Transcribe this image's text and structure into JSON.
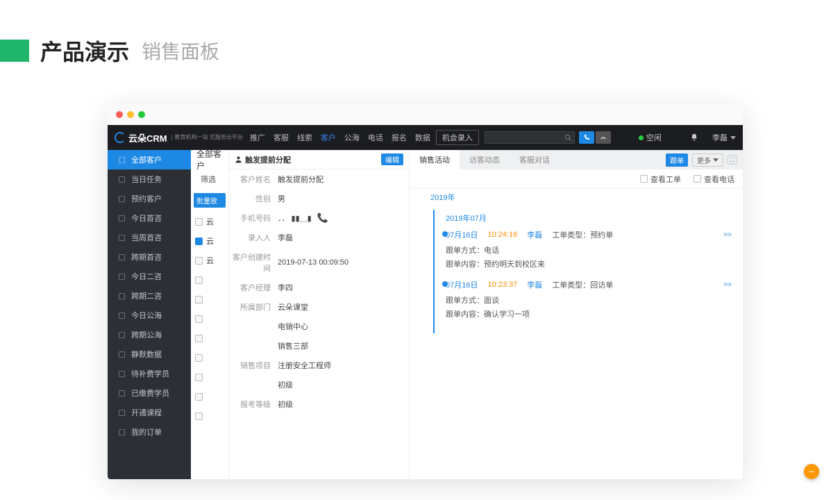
{
  "presentation": {
    "title": "产品演示",
    "subtitle": "销售面板"
  },
  "topnav": {
    "logo": "云朵CRM",
    "logo_sub": "教育机构一站\n式服务云平台",
    "items": [
      "推广",
      "客服",
      "线索",
      "客户",
      "公海",
      "电话",
      "报名",
      "数据"
    ],
    "active_index": 3,
    "chance_btn": "机会录入",
    "status": "空闲",
    "user": "李磊"
  },
  "sidebar": {
    "items": [
      {
        "icon": "user",
        "label": "全部客户"
      },
      {
        "icon": "check",
        "label": "当日任务"
      },
      {
        "icon": "people",
        "label": "预约客户"
      },
      {
        "icon": "chat",
        "label": "今日首咨"
      },
      {
        "icon": "chat",
        "label": "当周首咨"
      },
      {
        "icon": "chat",
        "label": "跨期首咨"
      },
      {
        "icon": "chat",
        "label": "今日二咨"
      },
      {
        "icon": "chat",
        "label": "跨期二咨"
      },
      {
        "icon": "sea",
        "label": "今日公海"
      },
      {
        "icon": "sea",
        "label": "跨期公海"
      },
      {
        "icon": "mute",
        "label": "静默数据"
      },
      {
        "icon": "pay",
        "label": "待补费学员"
      },
      {
        "icon": "paid",
        "label": "已缴费学员"
      },
      {
        "icon": "book",
        "label": "开通课程"
      },
      {
        "icon": "order",
        "label": "我的订单"
      }
    ],
    "active_index": 0
  },
  "mid": {
    "title": "全部客户",
    "filter": "筛选",
    "batch_btn": "批量放",
    "rows": [
      "云",
      "云",
      "云",
      "",
      "",
      "",
      "",
      "",
      "",
      "",
      ""
    ]
  },
  "detail": {
    "head_title": "触发提前分配",
    "edit": "编辑",
    "fields": [
      {
        "label": "客户姓名",
        "value": "触发提前分配"
      },
      {
        "label": "性别",
        "value": "男"
      },
      {
        "label": "手机号码",
        "value": "．． ▮▮␣▮",
        "phone": true
      },
      {
        "label": "录入人",
        "value": "李磊"
      },
      {
        "label": "客户创建时间",
        "value": "2019-07-13 00:09:50"
      },
      {
        "label": "客户经理",
        "value": "李四"
      },
      {
        "label": "所属部门",
        "value": "云朵课堂"
      },
      {
        "label": "",
        "value": "电销中心"
      },
      {
        "label": "",
        "value": "销售三部"
      },
      {
        "label": "销售项目",
        "value": "注册安全工程师"
      },
      {
        "label": "",
        "value": "初级"
      },
      {
        "label": "报考等级",
        "value": "初级"
      }
    ]
  },
  "activity": {
    "tabs": [
      "销售活动",
      "访客动态",
      "客服对话"
    ],
    "active_tab": 0,
    "follow_btn": "跟单",
    "more_btn": "更多",
    "check_ticket": "查看工单",
    "check_call": "查看电话",
    "year": "2019年",
    "month": "2019年07月",
    "entries": [
      {
        "date": "07月16日",
        "time": "10:24:16",
        "user": "李磊",
        "type_label": "工单类型：",
        "type": "预约单",
        "method_label": "跟单方式：",
        "method": "电话",
        "content_label": "跟单内容：",
        "content": "预约明天到校区来",
        "expand": ">>"
      },
      {
        "date": "07月16日",
        "time": "10:23:37",
        "user": "李磊",
        "type_label": "工单类型：",
        "type": "回访单",
        "method_label": "跟单方式：",
        "method": "面谈",
        "content_label": "跟单内容：",
        "content": "确认学习一项",
        "expand": ">>"
      }
    ]
  }
}
